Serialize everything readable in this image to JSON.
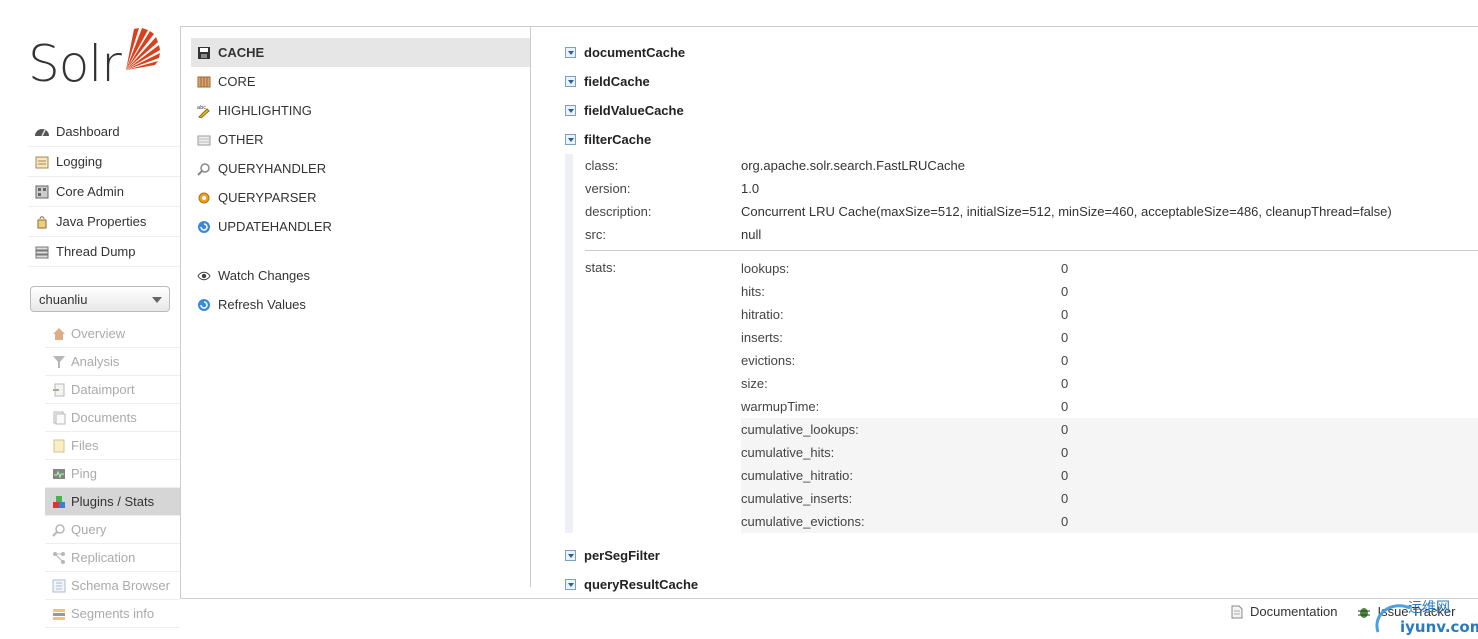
{
  "logo": {
    "text": "Solr"
  },
  "nav": [
    {
      "label": "Dashboard",
      "icon": "dashboard-icon"
    },
    {
      "label": "Logging",
      "icon": "logging-icon"
    },
    {
      "label": "Core Admin",
      "icon": "core-admin-icon"
    },
    {
      "label": "Java Properties",
      "icon": "java-properties-icon"
    },
    {
      "label": "Thread Dump",
      "icon": "thread-dump-icon"
    }
  ],
  "core_selector": {
    "value": "chuanliu"
  },
  "core_menu": [
    {
      "label": "Overview"
    },
    {
      "label": "Analysis"
    },
    {
      "label": "Dataimport"
    },
    {
      "label": "Documents"
    },
    {
      "label": "Files"
    },
    {
      "label": "Ping"
    },
    {
      "label": "Plugins / Stats"
    },
    {
      "label": "Query"
    },
    {
      "label": "Replication"
    },
    {
      "label": "Schema Browser"
    },
    {
      "label": "Segments info"
    }
  ],
  "categories": [
    {
      "label": "CACHE"
    },
    {
      "label": "CORE"
    },
    {
      "label": "HIGHLIGHTING"
    },
    {
      "label": "OTHER"
    },
    {
      "label": "QUERYHANDLER"
    },
    {
      "label": "QUERYPARSER"
    },
    {
      "label": "UPDATEHANDLER"
    }
  ],
  "actions": {
    "watch": "Watch Changes",
    "refresh": "Refresh Values"
  },
  "plugins_before": [
    "documentCache",
    "fieldCache",
    "fieldValueCache"
  ],
  "expanded_plugin": {
    "name": "filterCache",
    "fields": [
      {
        "key": "class:",
        "value": "org.apache.solr.search.FastLRUCache"
      },
      {
        "key": "version:",
        "value": "1.0"
      },
      {
        "key": "description:",
        "value": "Concurrent LRU Cache(maxSize=512, initialSize=512, minSize=460, acceptableSize=486, cleanupThread=false)"
      },
      {
        "key": "src:",
        "value": "null"
      }
    ],
    "stats_label": "stats:",
    "stats": [
      {
        "name": "lookups:",
        "value": "0"
      },
      {
        "name": "hits:",
        "value": "0"
      },
      {
        "name": "hitratio:",
        "value": "0"
      },
      {
        "name": "inserts:",
        "value": "0"
      },
      {
        "name": "evictions:",
        "value": "0"
      },
      {
        "name": "size:",
        "value": "0"
      },
      {
        "name": "warmupTime:",
        "value": "0"
      },
      {
        "name": "cumulative_lookups:",
        "value": "0"
      },
      {
        "name": "cumulative_hits:",
        "value": "0"
      },
      {
        "name": "cumulative_hitratio:",
        "value": "0"
      },
      {
        "name": "cumulative_inserts:",
        "value": "0"
      },
      {
        "name": "cumulative_evictions:",
        "value": "0"
      }
    ]
  },
  "plugins_after": [
    "perSegFilter",
    "queryResultCache"
  ],
  "footer": {
    "documentation": "Documentation",
    "issue_tracker": "Issue Tracker"
  },
  "watermark": {
    "line1": "运维网",
    "line2": "iyunv.com"
  },
  "colors": {
    "logo_accent": "#d9411e",
    "toggle_blue": "#2a5fa0"
  }
}
